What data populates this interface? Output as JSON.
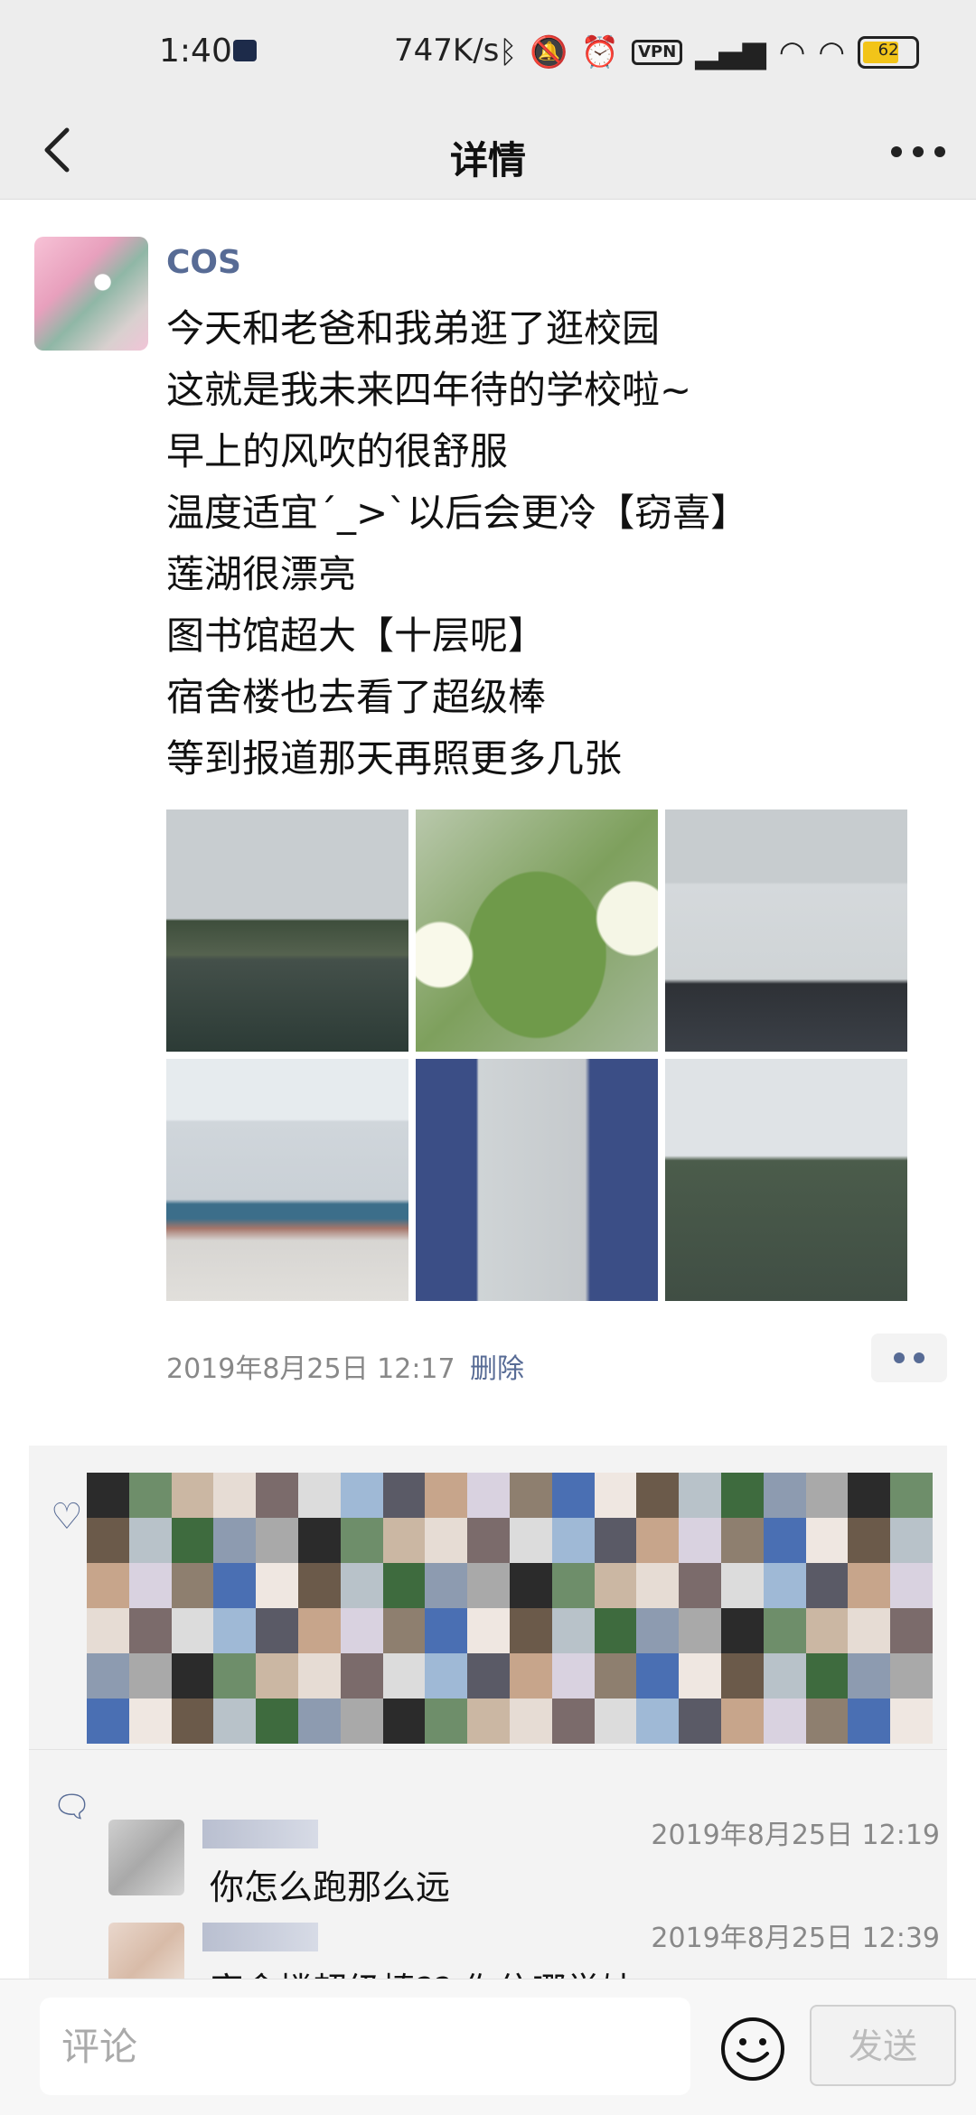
{
  "status_bar": {
    "time": "1:40",
    "network_speed": "747K/s",
    "vpn_label": "VPN",
    "battery": "62",
    "battery_color": "#f2c419"
  },
  "nav": {
    "title": "详情",
    "back_icon": "chevron-left-icon",
    "more_icon": "more-dots-icon"
  },
  "post": {
    "author": "COS",
    "lines": [
      "今天和老爸和我弟逛了逛校园",
      "这就是我未来四年待的学校啦~",
      "早上的风吹的很舒服",
      "温度适宜ˊ_>ˋ以后会更冷【窃喜】",
      "莲湖很漂亮",
      "图书馆超大【十层呢】",
      "宿舍楼也去看了超级棒",
      "等到报道那天再照更多几张"
    ],
    "photos": [
      "lake-photo",
      "water-lily-photo",
      "building-photo",
      "library-photo",
      "library-entrance-photo",
      "lake-view-photo"
    ],
    "timestamp": "2019年8月25日 12:17",
    "delete_label": "删除"
  },
  "social": {
    "like_icon": "heart-icon",
    "comment_icon": "comment-icon",
    "comments": [
      {
        "time": "2019年8月25日 12:19",
        "text": "你怎么跑那么远"
      },
      {
        "time": "2019年8月25日 12:39",
        "text": "宿舍楼超级棒?? 你住哪学妹"
      }
    ]
  },
  "composer": {
    "placeholder": "评论",
    "send_label": "发送"
  },
  "colors": {
    "link": "#576b95",
    "header_bg": "#ededed"
  }
}
